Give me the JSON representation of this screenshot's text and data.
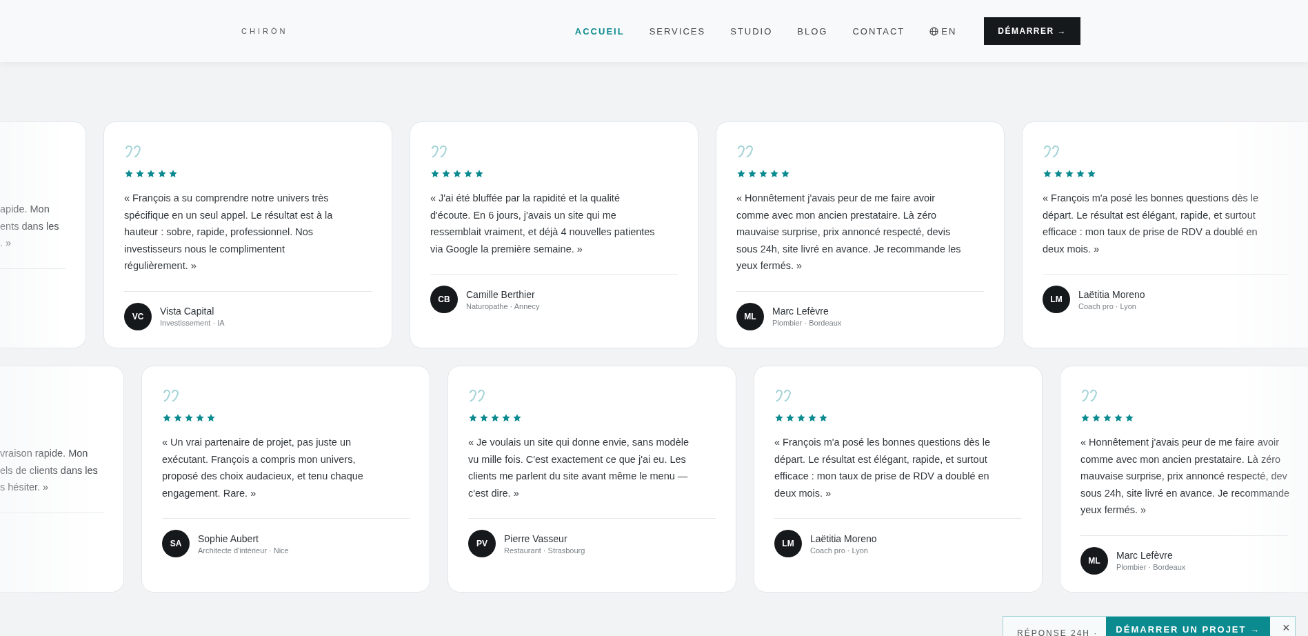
{
  "header": {
    "logo": "CHIRŌN",
    "nav": [
      {
        "label": "ACCUEIL",
        "selected": true
      },
      {
        "label": "SERVICES",
        "selected": false
      },
      {
        "label": "STUDIO",
        "selected": false
      },
      {
        "label": "BLOG",
        "selected": false
      },
      {
        "label": "CONTACT",
        "selected": false
      }
    ],
    "language": "EN",
    "cta": "DÉMARRER →"
  },
  "rows": [
    {
      "cards": [
        {
          "kind": "clipped_left",
          "lines": [
            "apide. Mon",
            "ents dans les",
            ". »"
          ]
        },
        {
          "kind": "full",
          "stars": 5,
          "lines": [
            "« François a su comprendre notre univers très",
            "spécifique en un seul appel. Le résultat est à la",
            "hauteur : sobre, rapide, professionnel. Nos",
            "investisseurs nous le complimentent",
            "régulièrement. »"
          ],
          "initials": "VC",
          "name": "Vista Capital",
          "role": "Investissement · IA"
        },
        {
          "kind": "full",
          "stars": 5,
          "lines": [
            "« J'ai été bluffée par la rapidité et la qualité",
            "d'écoute. En 6 jours, j'avais un site qui me",
            "ressemblait vraiment, et déjà 4 nouvelles patientes",
            "via Google la première semaine. »"
          ],
          "initials": "CB",
          "name": "Camille Berthier",
          "role": "Naturopathe · Annecy"
        },
        {
          "kind": "full",
          "stars": 5,
          "lines": [
            "« Honnêtement j'avais peur de me faire avoir",
            "comme avec mon ancien prestataire. Là zéro",
            "mauvaise surprise, prix annoncé respecté, devis",
            "sous 24h, site livré en avance. Je recommande les",
            "yeux fermés. »"
          ],
          "initials": "ML",
          "name": "Marc Lefèvre",
          "role": "Plombier · Bordeaux"
        },
        {
          "kind": "clipped_right",
          "stars": 5,
          "lines": [
            "« François m'a posé les bonnes questions dès le",
            "départ. Le résultat est élégant, rapide, et surtout",
            "efficace : mon taux de prise de RDV a doublé en",
            "deux mois. »"
          ],
          "initials": "LM",
          "name": "Laëtitia Moreno",
          "role": "Coach pro · Lyon"
        }
      ]
    },
    {
      "cards": [
        {
          "kind": "clipped_left",
          "lines": [
            "vraison rapide. Mon",
            "els de clients dans les",
            "s hésiter. »"
          ]
        },
        {
          "kind": "full",
          "stars": 5,
          "lines": [
            "« Un vrai partenaire de projet, pas juste un",
            "exécutant. François a compris mon univers,",
            "proposé des choix audacieux, et tenu chaque",
            "engagement. Rare. »"
          ],
          "initials": "SA",
          "name": "Sophie Aubert",
          "role": "Architecte d'intérieur · Nice"
        },
        {
          "kind": "full",
          "stars": 5,
          "lines": [
            "« Je voulais un site qui donne envie, sans modèle",
            "vu mille fois. C'est exactement ce que j'ai eu. Les",
            "clients me parlent du site avant même le menu —",
            "c'est dire. »"
          ],
          "initials": "PV",
          "name": "Pierre Vasseur",
          "role": "Restaurant · Strasbourg"
        },
        {
          "kind": "full",
          "stars": 5,
          "lines": [
            "« François m'a posé les bonnes questions dès le",
            "départ. Le résultat est élégant, rapide, et surtout",
            "efficace : mon taux de prise de RDV a doublé en",
            "deux mois. »"
          ],
          "initials": "LM",
          "name": "Laëtitia Moreno",
          "role": "Coach pro · Lyon"
        },
        {
          "kind": "clipped_right",
          "stars": 5,
          "lines": [
            "« Honnêtement j'avais peur de me faire avoir",
            "comme avec mon ancien prestataire. Là zéro",
            "mauvaise surprise, prix annoncé respecté, dev",
            "sous 24h, site livré en avance. Je recommande",
            "yeux fermés. »"
          ],
          "initials": "ML",
          "name": "Marc Lefèvre",
          "role": "Plombier · Bordeaux"
        }
      ]
    }
  ],
  "floating_cta": {
    "note": "RÉPONSE 24H ·",
    "button": "DÉMARRER UN PROJET →",
    "close": "×"
  }
}
